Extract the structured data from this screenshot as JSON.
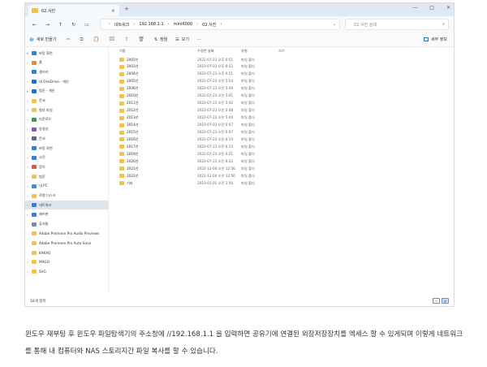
{
  "window": {
    "tab_title": "02.사진",
    "tab_close": "×",
    "new_tab": "+",
    "controls": [
      "—",
      "□",
      "×"
    ]
  },
  "nav_buttons": [
    "←",
    "→",
    "↑",
    "↻",
    "▭"
  ],
  "address": {
    "crumbs": [
      "네트워크",
      "192.168.1.1",
      "mini6000",
      "02.사진"
    ],
    "separator": "›",
    "chevron": "⌄"
  },
  "search": {
    "placeholder": "02.사진 검색",
    "icon": "search-icon"
  },
  "toolbar": {
    "new_label": "새로 만들기",
    "icons": [
      "cut-icon",
      "copy-icon",
      "paste-icon",
      "rename-icon",
      "share-icon",
      "delete-icon"
    ],
    "icon_glyphs": [
      "✂",
      "⧉",
      "📋",
      "⌧",
      "⇪",
      "🗑"
    ],
    "sort_label": "정렬",
    "view_label": "보기",
    "more_label": "···",
    "details_label": "세부 정보"
  },
  "sidebar": {
    "items": [
      {
        "label": "바탕 화면",
        "chev": "∨",
        "color": "#3a7bd5"
      },
      {
        "label": "홈",
        "chev": "›",
        "color": "#e58a3c"
      },
      {
        "label": "갤러리",
        "chev": "",
        "color": "#3a7bd5"
      },
      {
        "label": "내 OneDrive - 개인",
        "chev": "›",
        "color": "#1a73c9"
      },
      {
        "label": "범준 - 개인",
        "chev": "∨",
        "color": "#1a73c9"
      },
      {
        "label": "문서",
        "chev": "›",
        "color": "#f3c24a"
      },
      {
        "label": "첨부 파일",
        "chev": "›",
        "color": "#f3c24a"
      },
      {
        "label": "다운로드",
        "chev": "›",
        "color": "#2aa35a"
      },
      {
        "label": "동영상",
        "chev": "›",
        "color": "#8a4fc9"
      },
      {
        "label": "문서",
        "chev": "›",
        "color": "#5a6b7d"
      },
      {
        "label": "바탕 화면",
        "chev": "›",
        "color": "#3a7bd5"
      },
      {
        "label": "사진",
        "chev": "›",
        "color": "#3a7bd5"
      },
      {
        "label": "음악",
        "chev": "›",
        "color": "#e5553c"
      },
      {
        "label": "범준",
        "chev": "›",
        "color": "#f3c24a"
      },
      {
        "label": "내 PC",
        "chev": "›",
        "color": "#3a8fd5"
      },
      {
        "label": "로컬 디스크",
        "chev": "›",
        "color": "#f3c24a"
      },
      {
        "label": "네트워크",
        "chev": "›",
        "color": "#3a7bd5",
        "selected": true
      },
      {
        "label": "제어판",
        "chev": "›",
        "color": "#3a7bd5"
      },
      {
        "label": "휴지통",
        "chev": "",
        "color": "#6b8fb3"
      },
      {
        "label": "Adobe Premiere Pro Audio Previews",
        "chev": "",
        "color": "#f3c24a"
      },
      {
        "label": "Adobe Premiere Pro Auto-Save",
        "chev": "",
        "color": "#f3c24a"
      },
      {
        "label": "KAKAO",
        "chev": "",
        "color": "#f3c24a"
      },
      {
        "label": "MAGO",
        "chev": "›",
        "color": "#f3c24a"
      },
      {
        "label": "SVG",
        "chev": "›",
        "color": "#f3c24a"
      }
    ]
  },
  "columns": [
    "이름",
    "수정한 날짜",
    "유형",
    "크기"
  ],
  "files": [
    {
      "name": "2002년",
      "date": "2022-07-23 오후 6:51",
      "type": "파일 폴더"
    },
    {
      "name": "2003년",
      "date": "2022-07-23 오후 6:51",
      "type": "파일 폴더"
    },
    {
      "name": "2004년",
      "date": "2022-07-23 오후 6:51",
      "type": "파일 폴더"
    },
    {
      "name": "2005년",
      "date": "2022-07-23 오전 5:54",
      "type": "파일 폴더"
    },
    {
      "name": "2006년",
      "date": "2022-07-23 오전 5:40",
      "type": "파일 폴더"
    },
    {
      "name": "2010년",
      "date": "2022-07-23 오전 5:41",
      "type": "파일 폴더"
    },
    {
      "name": "2011년",
      "date": "2022-07-23 오전 5:42",
      "type": "파일 폴더"
    },
    {
      "name": "2012년",
      "date": "2022-07-23 오전 5:48",
      "type": "파일 폴더"
    },
    {
      "name": "2013년",
      "date": "2022-07-23 오전 5:44",
      "type": "파일 폴더"
    },
    {
      "name": "2014년",
      "date": "2022-07-23 오전 5:47",
      "type": "파일 폴더"
    },
    {
      "name": "2015년",
      "date": "2022-07-23 오전 6:07",
      "type": "파일 폴더"
    },
    {
      "name": "2016년",
      "date": "2022-07-23 오전 6:14",
      "type": "파일 폴더"
    },
    {
      "name": "2017년",
      "date": "2022-07-23 오전 6:15",
      "type": "파일 폴더"
    },
    {
      "name": "2019년",
      "date": "2022-07-23 오전 6:21",
      "type": "파일 폴더"
    },
    {
      "name": "2020년",
      "date": "2022-07-23 오전 6:22",
      "type": "파일 폴더"
    },
    {
      "name": "2021년",
      "date": "2022-12-04 오전 12:56",
      "type": "파일 폴더"
    },
    {
      "name": "2022년",
      "date": "2022-12-04 오전 12:56",
      "type": "파일 폴더"
    },
    {
      "name": "기타",
      "date": "2023-01-01 오전 2:56",
      "type": "파일 폴더"
    }
  ],
  "status": {
    "count": "18개 항목",
    "view_icons": [
      "≡",
      "▦"
    ]
  },
  "caption": "윈도우 재부팅 후 윈도우 파일탐색기의 주소창에 //192.168.1.1 을 입력하면 공유기에 연결된 외장저장장치를 엑세스 할 수 있게되며 이렇게 네트워크를 통해 내 컴퓨터와 NAS 스토리지간 파일 복사를 할 수 있습니다."
}
